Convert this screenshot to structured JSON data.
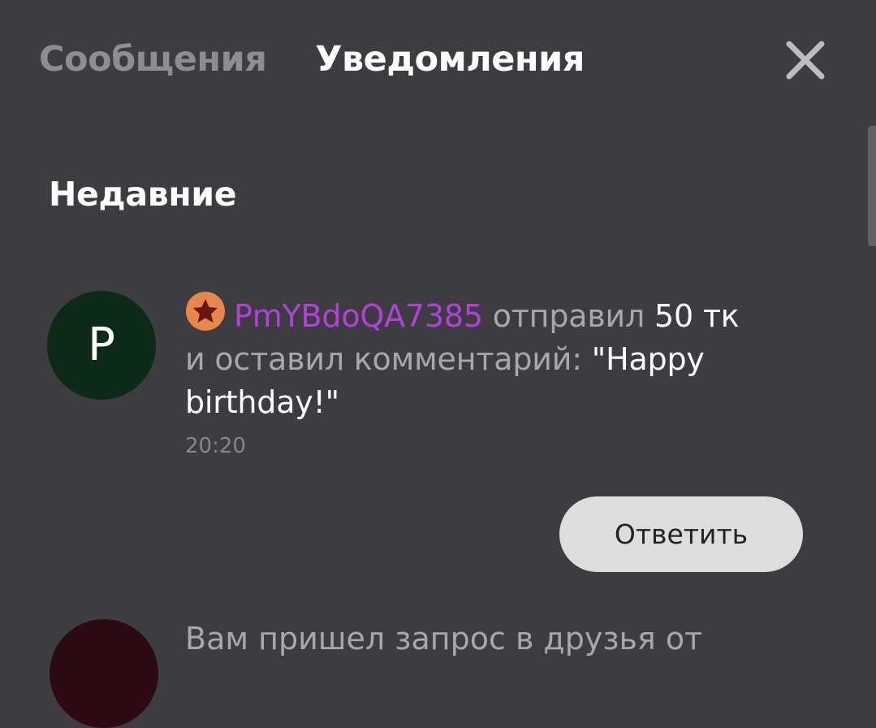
{
  "tabs": {
    "messages": "Сообщения",
    "notifications": "Уведомления"
  },
  "close_icon": "close-icon",
  "section_title": "Недавние",
  "notification": {
    "avatar_letter": "P",
    "avatar_color": "#0c2a17",
    "badge_icon": "star-badge-icon",
    "username": "PmYBdoQA7385",
    "username_color": "#b53fdc",
    "sent_word": "отправил",
    "amount": "50 тк",
    "middle_text": "и оставил комментарий:",
    "comment": "\"Happy birthday!\"",
    "time": "20:20",
    "reply_label": "Ответить"
  },
  "next_notification": {
    "avatar_color": "#2b0a13",
    "text": "Вам пришел запрос в друзья от"
  }
}
